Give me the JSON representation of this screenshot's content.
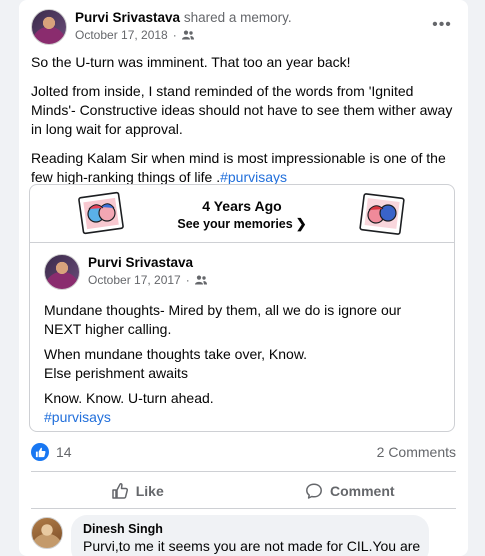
{
  "post": {
    "author": "Purvi Srivastava",
    "action": " shared a memory.",
    "date": "October 17, 2018",
    "separator": "·",
    "more_label": "•••",
    "paragraphs": [
      "So the U-turn was imminent. That too an year back!",
      "Jolted from inside, I stand reminded of the words from 'Ignited Minds'- Constructive ideas should not have to see them wither away in long wait for approval."
    ],
    "last_paragraph_text": "Reading Kalam Sir when mind is most impressionable is one of the few high-ranking things of life .",
    "hashtag": "#purvisays"
  },
  "memory": {
    "title": "4 Years Ago",
    "link": "See your memories",
    "chevron": "❯",
    "inner_author": "Purvi Srivastava",
    "inner_date": "October 17, 2017",
    "separator": "·",
    "inner_lines": [
      "Mundane thoughts- Mired by them, all we do is ignore our NEXT higher calling.",
      "When mundane thoughts take over, Know.",
      "Else perishment awaits",
      "Know. Know. U-turn ahead."
    ],
    "inner_hashtag": "#purvisays"
  },
  "stats": {
    "likes": "14",
    "comments": "2 Comments"
  },
  "actions": {
    "like": "Like",
    "comment": "Comment"
  },
  "comment": {
    "name": "Dinesh Singh",
    "text": "Purvi,to me it seems you are not made for CIL.You are"
  },
  "colors": {
    "accent": "#1877f2",
    "hashtag": "#216fdb",
    "muted": "#65676b"
  }
}
